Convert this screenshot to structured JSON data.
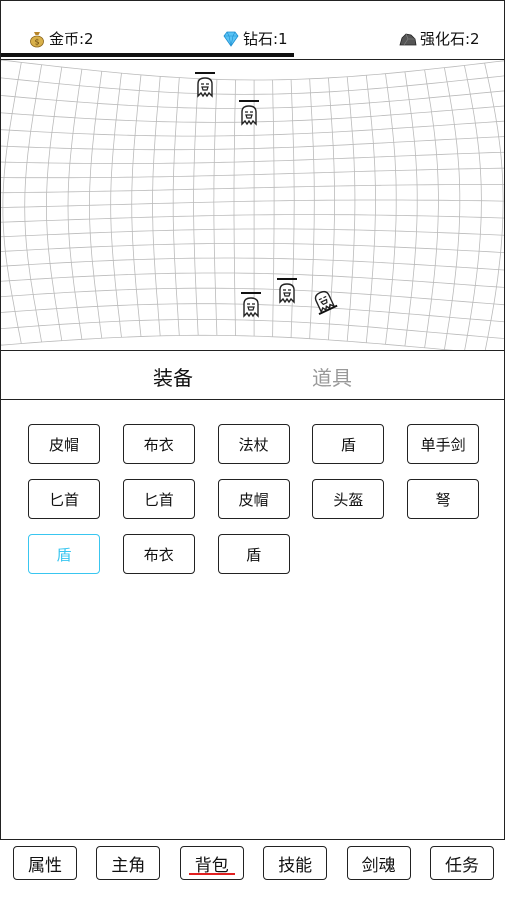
{
  "currencies": {
    "gold": {
      "label": "金币:2",
      "icon": "money-bag-icon",
      "color": "#c9a23a"
    },
    "diamond": {
      "label": "钻石:1",
      "icon": "diamond-icon",
      "color": "#3fb1f0"
    },
    "stone": {
      "label": "强化石:2",
      "icon": "rock-icon",
      "color": "#444444"
    }
  },
  "progress": {
    "fraction": 0.58
  },
  "bag": {
    "tabs": [
      {
        "label": "装备",
        "active": true
      },
      {
        "label": "道具",
        "active": false
      }
    ],
    "items": [
      {
        "label": "皮帽",
        "selected": false
      },
      {
        "label": "布衣",
        "selected": false
      },
      {
        "label": "法杖",
        "selected": false
      },
      {
        "label": "盾",
        "selected": false
      },
      {
        "label": "单手剑",
        "selected": false
      },
      {
        "label": "匕首",
        "selected": false
      },
      {
        "label": "匕首",
        "selected": false
      },
      {
        "label": "皮帽",
        "selected": false
      },
      {
        "label": "头盔",
        "selected": false
      },
      {
        "label": "弩",
        "selected": false
      },
      {
        "label": "盾",
        "selected": true
      },
      {
        "label": "布衣",
        "selected": false
      },
      {
        "label": "盾",
        "selected": false
      }
    ]
  },
  "nav": [
    {
      "label": "属性",
      "active": false
    },
    {
      "label": "主角",
      "active": false
    },
    {
      "label": "背包",
      "active": true
    },
    {
      "label": "技能",
      "active": false
    },
    {
      "label": "剑魂",
      "active": false
    },
    {
      "label": "任务",
      "active": false
    }
  ],
  "colors": {
    "selected": "#39c6f0",
    "nav_underline": "#e02020"
  }
}
